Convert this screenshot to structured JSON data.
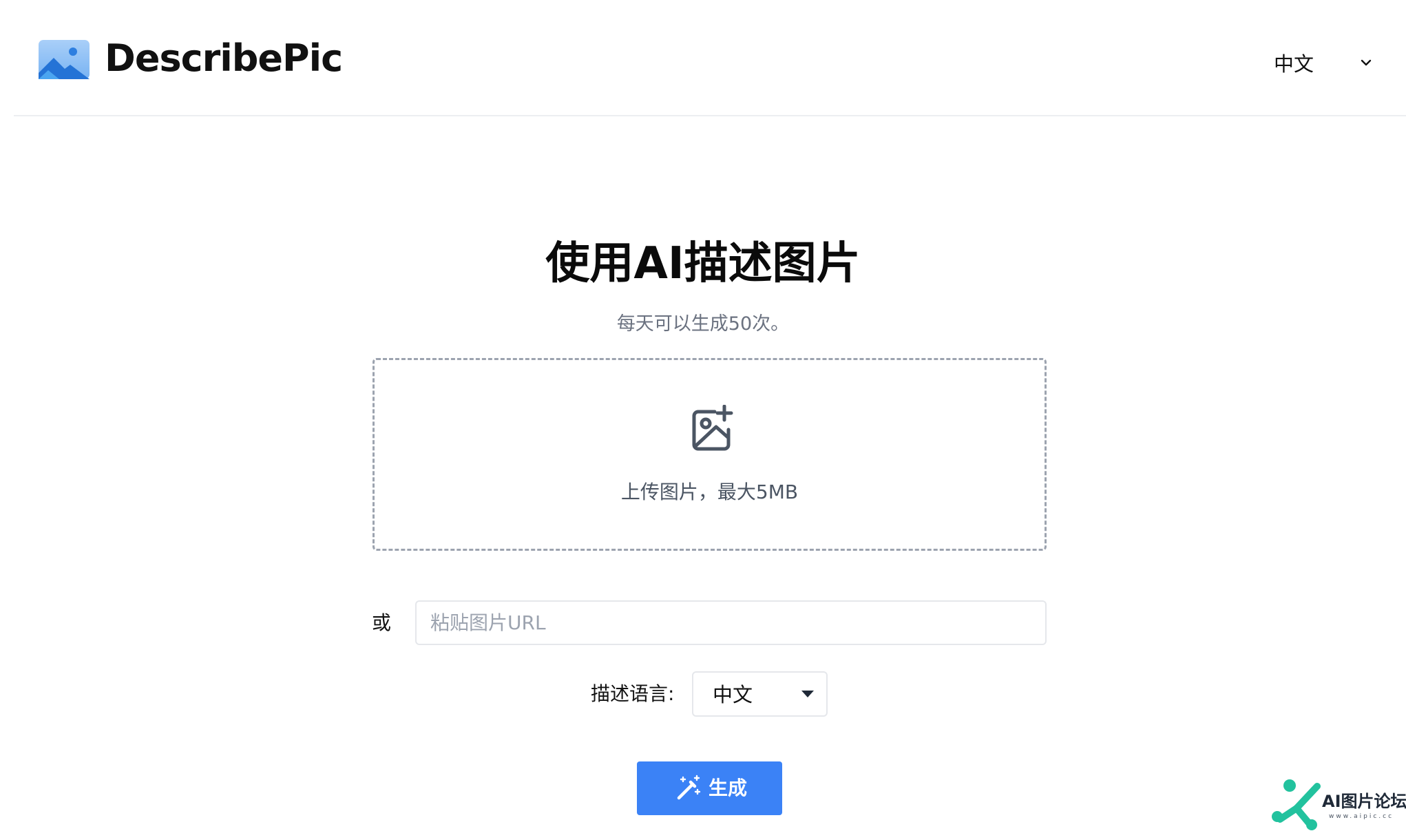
{
  "header": {
    "brand": "DescribePic",
    "language": "中文",
    "logo_icon": "image-mountain-icon",
    "chevron_icon": "chevron-down-icon"
  },
  "hero": {
    "title": "使用AI描述图片",
    "subtitle": "每天可以生成50次。"
  },
  "upload": {
    "icon": "image-plus-icon",
    "label": "上传图片，最大5MB"
  },
  "url": {
    "or_label": "或",
    "placeholder": "粘贴图片URL",
    "value": ""
  },
  "description_language": {
    "label": "描述语言:",
    "selected": "中文",
    "caret_icon": "caret-down-icon"
  },
  "generate": {
    "label": "生成",
    "icon": "magic-wand-icon",
    "color": "#3b82f6"
  },
  "watermark": {
    "text": "AI图片论坛",
    "url": "www.aipic.cc",
    "color": "#22c29e"
  }
}
